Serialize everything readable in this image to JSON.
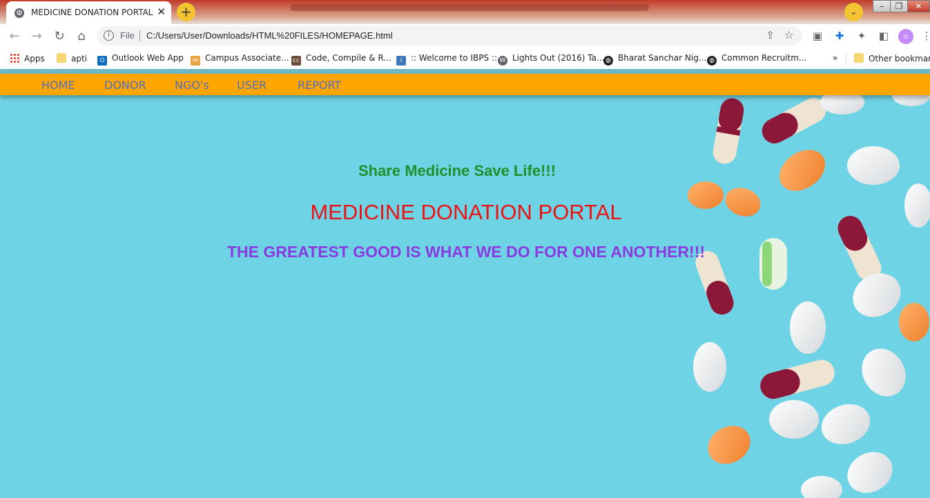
{
  "browser": {
    "tab_title": "MEDICINE DONATION PORTAL",
    "close_glyph": "✕",
    "new_tab_glyph": "+",
    "url_scheme": "File",
    "url": "C:/Users/User/Downloads/HTML%20FILES/HOMEPAGE.html",
    "bookmarks": [
      "Apps",
      "apti",
      "Outlook Web App",
      "Campus Associate...",
      "Code, Compile & R...",
      ":: Welcome to IBPS ::",
      "Lights Out (2016) Ta...",
      "Bharat Sanchar Nig...",
      "Common Recruitm..."
    ],
    "more_bookmarks_glyph": "»",
    "other_bookmarks": "Other bookmarks"
  },
  "nav": {
    "home": "HOME",
    "donor": "DONOR",
    "ngos": "NGO's",
    "user": "USER",
    "report": "REPORT"
  },
  "hero": {
    "tagline": "Share Medicine Save Life!!!",
    "brand": "MEDICINE DONATION PORTAL",
    "motto": "THE GREATEST GOOD IS WHAT WE DO FOR ONE ANOTHER!!!"
  },
  "colors": {
    "navbar_bg": "#ffa500",
    "nav_link": "#4f6fc4",
    "page_bg": "#6fd3e6",
    "tagline": "#1f8f2a",
    "brand": "#ee1111",
    "motto": "#8a3be0"
  }
}
